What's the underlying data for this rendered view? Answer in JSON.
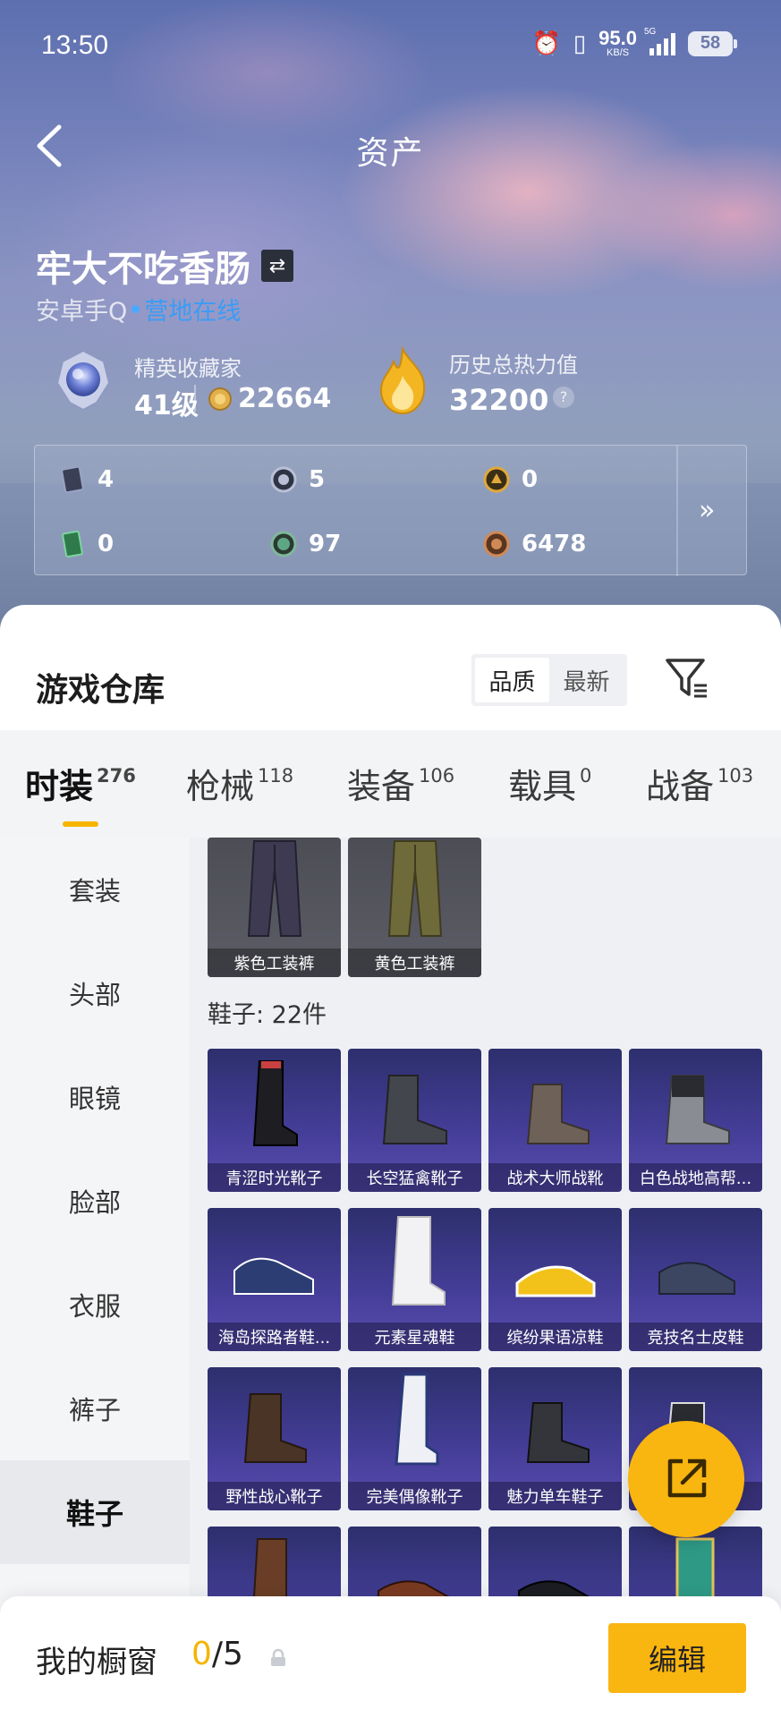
{
  "status_bar": {
    "time": "13:50",
    "net_speed_value": "95.0",
    "net_speed_unit": "KB/S",
    "network_type": "5G",
    "battery": "58"
  },
  "header": {
    "title": "资产"
  },
  "profile": {
    "username": "牢大不吃香肠",
    "platform": "安卓手Q",
    "online_status": "营地在线",
    "rank_title": "精英收藏家",
    "rank_level": "41级",
    "coins": "22664",
    "heat_label": "历史总热力值",
    "heat_value": "32200",
    "help": "?"
  },
  "currencies": [
    {
      "icon": "card-icon",
      "value": "4"
    },
    {
      "icon": "silver-token-icon",
      "value": "5"
    },
    {
      "icon": "gold-token-icon",
      "value": "0"
    },
    {
      "icon": "green-ticket-icon",
      "value": "0"
    },
    {
      "icon": "green-orb-icon",
      "value": "97"
    },
    {
      "icon": "bronze-token-icon",
      "value": "6478"
    }
  ],
  "warehouse": {
    "title": "游戏仓库",
    "sort_options": [
      "品质",
      "最新"
    ],
    "sort_active": "品质",
    "tabs": [
      {
        "label": "时装",
        "count": "276"
      },
      {
        "label": "枪械",
        "count": "118"
      },
      {
        "label": "装备",
        "count": "106"
      },
      {
        "label": "载具",
        "count": "0"
      },
      {
        "label": "战备",
        "count": "103"
      }
    ],
    "active_tab": "时装",
    "categories": [
      "套装",
      "头部",
      "眼镜",
      "脸部",
      "衣服",
      "裤子",
      "鞋子"
    ],
    "active_category": "鞋子",
    "pants_items": [
      "紫色工装裤",
      "黄色工装裤"
    ],
    "shoes_header": "鞋子: 22件",
    "shoes_items": [
      "青涩时光靴子",
      "长空猛禽靴子",
      "战术大师战靴",
      "白色战地高帮...",
      "海岛探路者鞋...",
      "元素星魂鞋",
      "缤纷果语凉鞋",
      "竞技名士皮鞋",
      "野性战心靴子",
      "完美偶像靴子",
      "魅力单车鞋子",
      "",
      "",
      "",
      "",
      ""
    ]
  },
  "showcase": {
    "label": "我的橱窗",
    "current": "0",
    "separator": "/",
    "max": "5",
    "edit_label": "编辑"
  },
  "colors": {
    "accent": "#f9b510",
    "online": "#3a9cf5",
    "card_purple": "#433d96"
  }
}
